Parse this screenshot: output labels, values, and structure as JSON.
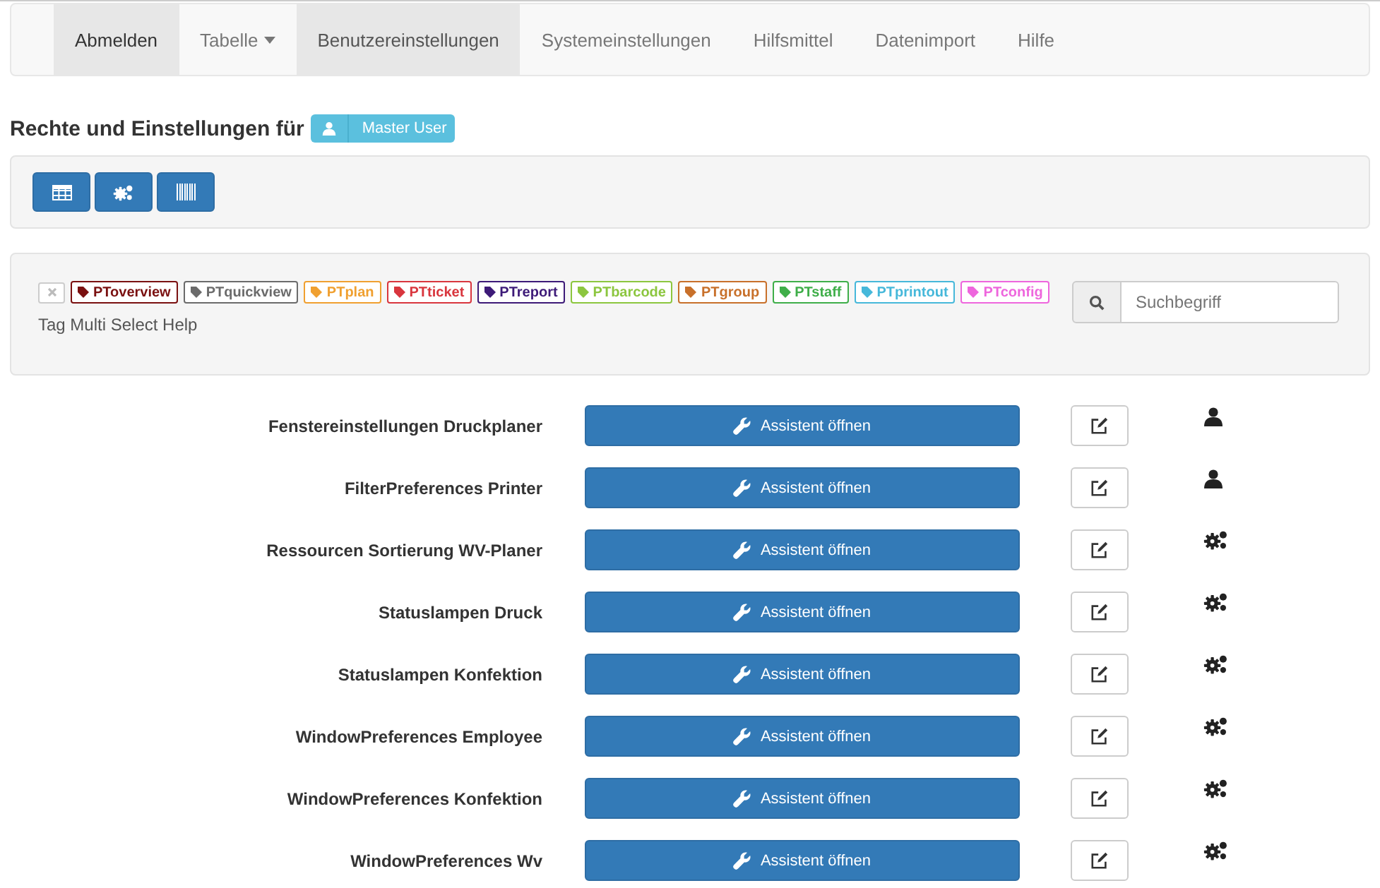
{
  "nav": [
    {
      "label": "Abmelden",
      "selected": true,
      "kind": "link"
    },
    {
      "label": "Tabelle",
      "selected": false,
      "kind": "dropdown"
    },
    {
      "label": "Benutzereinstellungen",
      "selected": true,
      "kind": "link"
    },
    {
      "label": "Systemeinstellungen",
      "selected": false,
      "kind": "link"
    },
    {
      "label": "Hilfsmittel",
      "selected": false,
      "kind": "link"
    },
    {
      "label": "Datenimport",
      "selected": false,
      "kind": "link"
    },
    {
      "label": "Hilfe",
      "selected": false,
      "kind": "link"
    }
  ],
  "heading": {
    "text": "Rechte und Einstellungen für",
    "user": "Master User"
  },
  "toolbar": [
    {
      "kind": "table"
    },
    {
      "kind": "gears"
    },
    {
      "kind": "barcode"
    }
  ],
  "tags": [
    {
      "label": "PToverview",
      "color": "#7a1010"
    },
    {
      "label": "PTquickview",
      "color": "#6b6b6b"
    },
    {
      "label": "PTplan",
      "color": "#f0a030"
    },
    {
      "label": "PTticket",
      "color": "#d9363e"
    },
    {
      "label": "PTreport",
      "color": "#3d1a78"
    },
    {
      "label": "PTbarcode",
      "color": "#8cc63f"
    },
    {
      "label": "PTgroup",
      "color": "#c8702a"
    },
    {
      "label": "PTstaff",
      "color": "#3fae49"
    },
    {
      "label": "PTprintout",
      "color": "#46b8da"
    },
    {
      "label": "PTconfig",
      "color": "#ee66dd"
    }
  ],
  "tag_help": "Tag Multi Select Help",
  "search": {
    "placeholder": "Suchbegriff"
  },
  "settings": [
    {
      "name": "Fenstereinstellungen Druckplaner",
      "button": "Assistent öffnen",
      "kind": "user"
    },
    {
      "name": "FilterPreferences Printer",
      "button": "Assistent öffnen",
      "kind": "user"
    },
    {
      "name": "Ressourcen Sortierung WV-Planer",
      "button": "Assistent öffnen",
      "kind": "system"
    },
    {
      "name": "Statuslampen Druck",
      "button": "Assistent öffnen",
      "kind": "system"
    },
    {
      "name": "Statuslampen Konfektion",
      "button": "Assistent öffnen",
      "kind": "system"
    },
    {
      "name": "WindowPreferences Employee",
      "button": "Assistent öffnen",
      "kind": "system"
    },
    {
      "name": "WindowPreferences Konfektion",
      "button": "Assistent öffnen",
      "kind": "system"
    },
    {
      "name": "WindowPreferences Wv",
      "button": "Assistent öffnen",
      "kind": "system"
    }
  ]
}
